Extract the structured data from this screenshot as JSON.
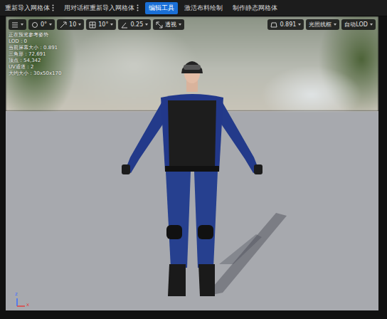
{
  "toolbar": [
    {
      "label": "重新导入网格体",
      "selected": false,
      "menu": true
    },
    {
      "label": "用对话框重新导入网格体",
      "selected": false,
      "menu": true
    },
    {
      "label": "编辑工具",
      "selected": true,
      "menu": false
    },
    {
      "label": "激活布料绘制",
      "selected": false,
      "menu": false
    },
    {
      "label": "制作静态网格体",
      "selected": false,
      "menu": false
    }
  ],
  "viewport_controls": [
    "0°",
    "10",
    "10°",
    "0.25",
    "透视",
    "0.891",
    "光照线框",
    "自动LOD"
  ],
  "overlay_stats": [
    "正在预览参考姿势",
    "LOD：0",
    "当前屏幕大小：0.891",
    "三角形：72,691",
    "顶点：54,342",
    "UV通道：2",
    "大约大小：30x50x170"
  ],
  "axes": [
    "z",
    "x"
  ]
}
